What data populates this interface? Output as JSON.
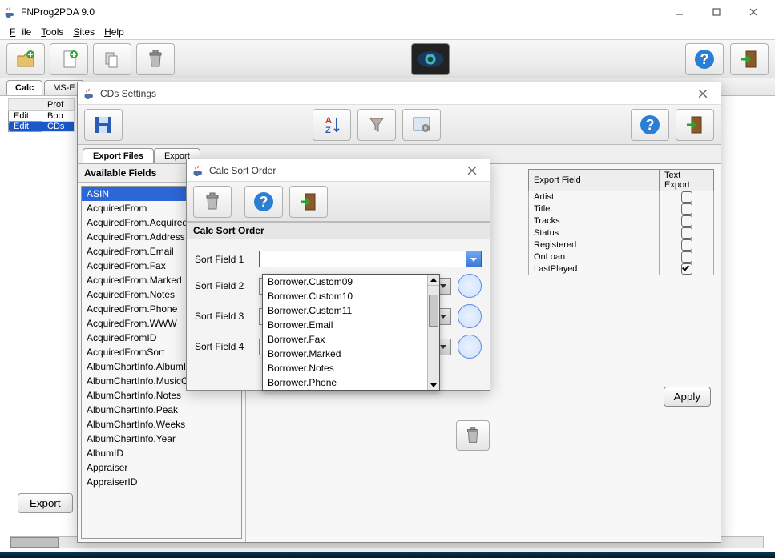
{
  "window": {
    "title": "FNProg2PDA 9.0",
    "menu": {
      "file": "File",
      "tools": "Tools",
      "sites": "Sites",
      "help": "Help"
    }
  },
  "main_tabs": {
    "calc": "Calc",
    "ms": "MS-E"
  },
  "profile_table": {
    "col_profile": "Prof",
    "rows": [
      {
        "edit": "Edit",
        "name": "Boo"
      },
      {
        "edit": "Edit",
        "name": "CDs"
      }
    ]
  },
  "export_btn": "Export",
  "cds_dlg": {
    "title": "CDs Settings",
    "tabs": {
      "export_files": "Export Files",
      "export2": "Export"
    },
    "avail_header": "Available Fields",
    "avail_fields": [
      "ASIN",
      "AcquiredFrom",
      "AcquiredFrom.AcquiredFrom",
      "AcquiredFrom.Address",
      "AcquiredFrom.Email",
      "AcquiredFrom.Fax",
      "AcquiredFrom.Marked",
      "AcquiredFrom.Notes",
      "AcquiredFrom.Phone",
      "AcquiredFrom.WWW",
      "AcquiredFromID",
      "AcquiredFromSort",
      "AlbumChartInfo.AlbumID",
      "AlbumChartInfo.MusicChartID",
      "AlbumChartInfo.Notes",
      "AlbumChartInfo.Peak",
      "AlbumChartInfo.Weeks",
      "AlbumChartInfo.Year",
      "AlbumID",
      "Appraiser",
      "AppraiserID"
    ],
    "export_table": {
      "col1": "Export Field",
      "col2": "Text Export",
      "rows": [
        {
          "f": "Artist",
          "c": false
        },
        {
          "f": "Title",
          "c": false
        },
        {
          "f": "Tracks",
          "c": false
        },
        {
          "f": "Status",
          "c": false
        },
        {
          "f": "Registered",
          "c": false
        },
        {
          "f": "OnLoan",
          "c": false
        },
        {
          "f": "LastPlayed",
          "c": true
        }
      ]
    },
    "apply": "Apply"
  },
  "sort_dlg": {
    "title": "Calc Sort Order",
    "section": "Calc Sort Order",
    "labels": {
      "f1": "Sort Field 1",
      "f2": "Sort Field 2",
      "f3": "Sort Field 3",
      "f4": "Sort Field 4"
    },
    "dropdown": [
      "Borrower.Custom09",
      "Borrower.Custom10",
      "Borrower.Custom11",
      "Borrower.Email",
      "Borrower.Fax",
      "Borrower.Marked",
      "Borrower.Notes",
      "Borrower.Phone"
    ]
  }
}
